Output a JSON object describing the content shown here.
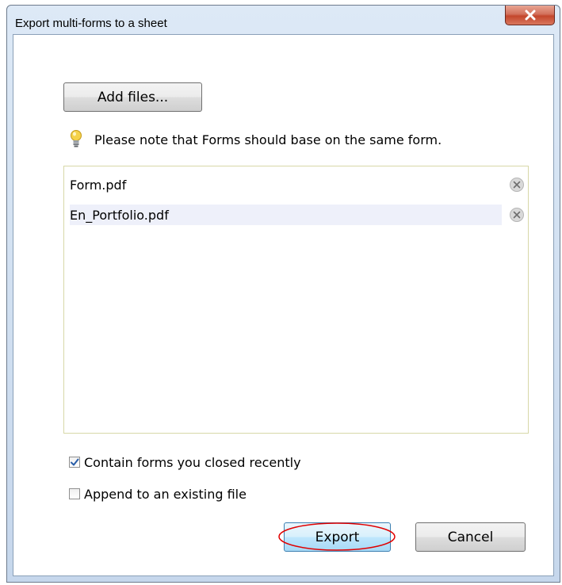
{
  "dialog": {
    "title": "Export multi-forms to a sheet",
    "close_icon": "close-x-icon"
  },
  "add_files_label": "Add files...",
  "note": {
    "icon": "lightbulb-icon",
    "text": "Please note that Forms should base on the same form."
  },
  "files": [
    {
      "name": "Form.pdf",
      "selected": false,
      "remove_icon": "remove-circle-x-icon"
    },
    {
      "name": "En_Portfolio.pdf",
      "selected": true,
      "remove_icon": "remove-circle-x-icon"
    }
  ],
  "options": [
    {
      "label": "Contain forms you closed recently",
      "checked": true
    },
    {
      "label": "Append to an existing file",
      "checked": false
    }
  ],
  "buttons": {
    "export_label": "Export",
    "cancel_label": "Cancel"
  },
  "colors": {
    "highlight_ring": "#e00000",
    "selected_row": "#eef0fa"
  }
}
